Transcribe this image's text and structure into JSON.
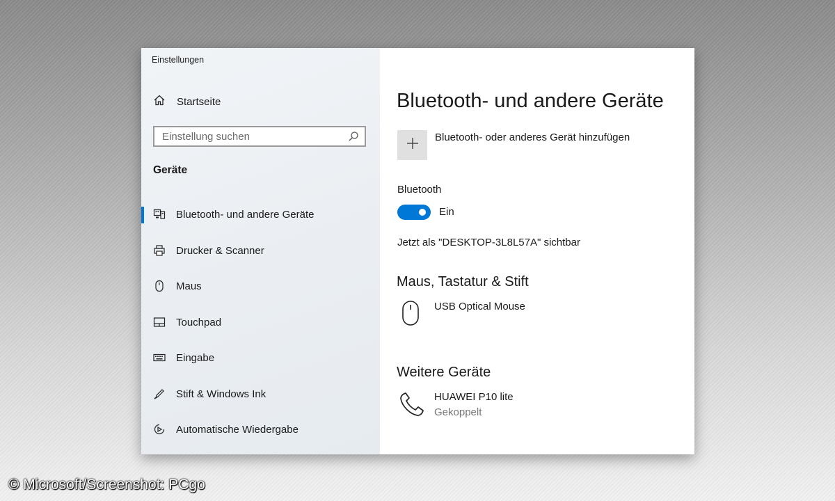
{
  "window": {
    "title": "Einstellungen"
  },
  "sidebar": {
    "home_label": "Startseite",
    "search_placeholder": "Einstellung suchen",
    "section_label": "Geräte",
    "items": [
      {
        "label": "Bluetooth- und andere Geräte",
        "icon": "bluetooth-devices-icon",
        "selected": true
      },
      {
        "label": "Drucker & Scanner",
        "icon": "printer-icon",
        "selected": false
      },
      {
        "label": "Maus",
        "icon": "mouse-icon",
        "selected": false
      },
      {
        "label": "Touchpad",
        "icon": "touchpad-icon",
        "selected": false
      },
      {
        "label": "Eingabe",
        "icon": "keyboard-icon",
        "selected": false
      },
      {
        "label": "Stift & Windows Ink",
        "icon": "pen-icon",
        "selected": false
      },
      {
        "label": "Automatische Wiedergabe",
        "icon": "autoplay-icon",
        "selected": false
      }
    ]
  },
  "main": {
    "title": "Bluetooth- und andere Geräte",
    "add_device_label": "Bluetooth- oder anderes Gerät hinzufügen",
    "bluetooth_label": "Bluetooth",
    "bluetooth_state": "Ein",
    "bluetooth_on": true,
    "visibility_text": "Jetzt als \"DESKTOP-3L8L57A\" sichtbar",
    "sections": [
      {
        "title": "Maus, Tastatur & Stift",
        "devices": [
          {
            "name": "USB Optical Mouse",
            "status": "",
            "icon": "mouse-icon"
          }
        ]
      },
      {
        "title": "Weitere Geräte",
        "devices": [
          {
            "name": "HUAWEI P10 lite",
            "status": "Gekoppelt",
            "icon": "phone-icon"
          }
        ]
      }
    ]
  },
  "colors": {
    "accent": "#0078d7",
    "sidebar_bg": "#eef1f4",
    "add_tile": "#e0e0e0"
  },
  "watermark": "© Microsoft/Screenshot: PCgo"
}
